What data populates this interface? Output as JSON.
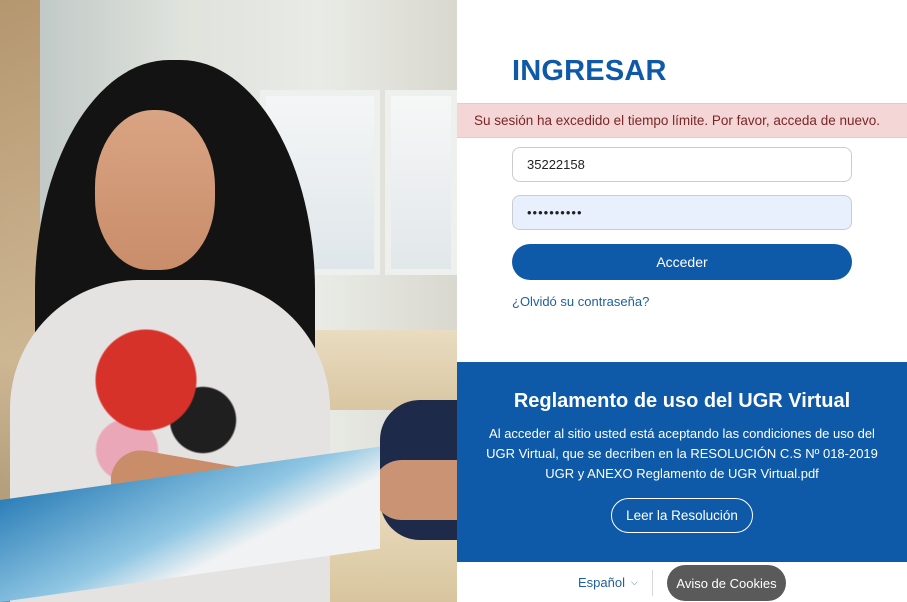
{
  "login": {
    "title": "INGRESAR",
    "alert": "Su sesión ha excedido el tiempo límite. Por favor, acceda de nuevo.",
    "username_value": "35222158",
    "password_value": "••••••••••",
    "submit_label": "Acceder",
    "forgot_label": "¿Olvidó su contraseña?"
  },
  "rules": {
    "title": "Reglamento de uso del UGR Virtual",
    "text": "Al acceder al sitio usted está aceptando las condiciones de uso del UGR Virtual, que se decriben en la RESOLUCIÓN C.S Nº 018-2019 UGR y ANEXO Reglamento de UGR Virtual.pdf",
    "button_label": "Leer la Resolución"
  },
  "footer": {
    "language": "Español",
    "cookies_label": "Aviso de Cookies"
  },
  "colors": {
    "primary": "#0e5aa8",
    "alert_bg": "#f4d6d6",
    "alert_text": "#7a2626",
    "cookies_button": "#5a5a5a"
  },
  "icons": {
    "language_dropdown": "chevron-down-icon"
  }
}
